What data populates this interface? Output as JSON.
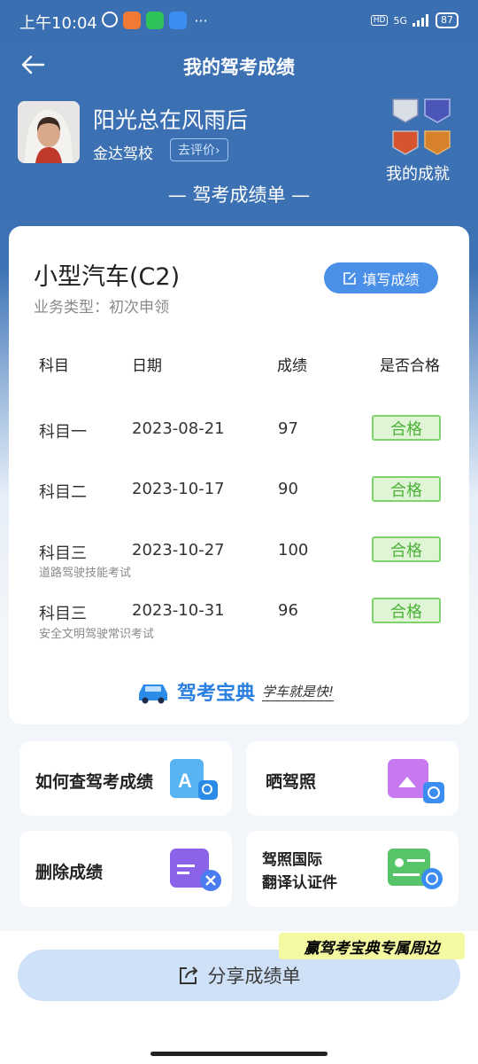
{
  "status": {
    "time": "上午10:04",
    "network": "5G",
    "battery": "87"
  },
  "nav": {
    "title": "我的驾考成绩"
  },
  "profile": {
    "name": "阳光总在风雨后",
    "school": "金达驾校",
    "rate_label": "去评价",
    "achievements_label": "我的成就"
  },
  "sheet_title": "— 驾考成绩单 —",
  "card": {
    "vehicle_type": "小型汽车(C2)",
    "business_type": "业务类型：初次申领",
    "fill_button": "填写成绩",
    "headers": {
      "subject": "科目",
      "date": "日期",
      "score": "成绩",
      "pass": "是否合格"
    },
    "rows": [
      {
        "subject": "科目一",
        "date": "2023-08-21",
        "score": "97",
        "result": "合格",
        "note": ""
      },
      {
        "subject": "科目二",
        "date": "2023-10-17",
        "score": "90",
        "result": "合格",
        "note": ""
      },
      {
        "subject": "科目三",
        "date": "2023-10-27",
        "score": "100",
        "result": "合格",
        "note": "道路驾驶技能考试"
      },
      {
        "subject": "科目三",
        "date": "2023-10-31",
        "score": "96",
        "result": "合格",
        "note": "安全文明驾驶常识考试"
      }
    ],
    "brand": {
      "name": "驾考宝典",
      "slogan": "学车就是快!"
    }
  },
  "tiles": [
    {
      "label": "如何查驾考成绩",
      "icon": "document-search-icon",
      "color": "#56b4f2"
    },
    {
      "label": "晒驾照",
      "icon": "photo-camera-icon",
      "color": "#c77af0"
    },
    {
      "label": "删除成绩",
      "icon": "clipboard-delete-icon",
      "color": "#8a63e8"
    },
    {
      "label_line1": "驾照国际",
      "label_line2": "翻译认证件",
      "icon": "id-card-translate-icon",
      "color": "#58c46a"
    }
  ],
  "promo": {
    "text": "赢驾考宝典专属周边"
  },
  "share": {
    "label": "分享成绩单"
  }
}
